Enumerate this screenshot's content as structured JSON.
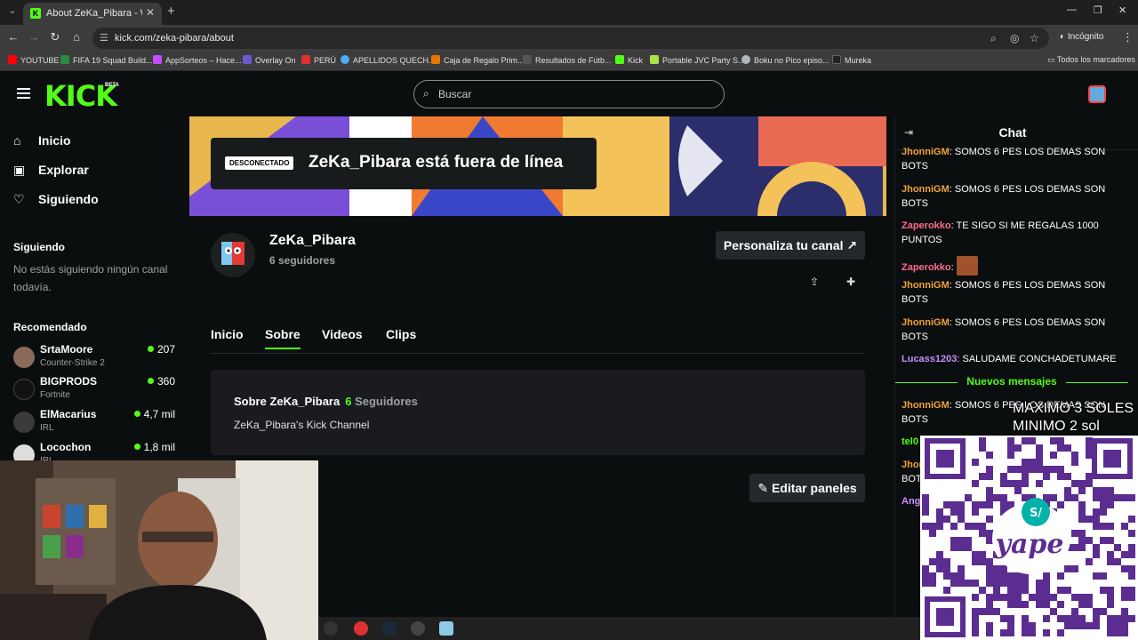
{
  "browser": {
    "tab_title": "About ZeKa_Pibara - Watch Live",
    "url": "kick.com/zeka-pibara/about",
    "incognito_label": "Incógnito",
    "bookmarks": [
      "YOUTUBE",
      "FIFA 19 Squad Build...",
      "AppSorteos – Hace...",
      "Overlay On",
      "PERÚ",
      "APELLIDOS QUECH...",
      "Caja de Regalo Prim...",
      "Resultados de Fútb...",
      "Kick",
      "Portable JVC Party S...",
      "Boku no Pico episo...",
      "Mureka"
    ],
    "all_bookmarks": "Todos los marcadores"
  },
  "header": {
    "logo": "KICK",
    "logo_badge": "BETA",
    "search_placeholder": "Buscar"
  },
  "sidebar": {
    "nav": [
      {
        "label": "Inicio",
        "icon": "home-icon"
      },
      {
        "label": "Explorar",
        "icon": "compass-icon"
      },
      {
        "label": "Siguiendo",
        "icon": "heart-icon"
      }
    ],
    "following_title": "Siguiendo",
    "following_empty": "No estás siguiendo ningún canal todavía.",
    "recommended_title": "Recomendado",
    "recommended": [
      {
        "name": "SrtaMoore",
        "category": "Counter-Strike 2",
        "viewers": "207"
      },
      {
        "name": "BIGPRODS",
        "category": "Fortnite",
        "viewers": "360"
      },
      {
        "name": "ElMacarius",
        "category": "IRL",
        "viewers": "4,7 mil"
      },
      {
        "name": "Locochon",
        "category": "IRL",
        "viewers": "1,8 mil"
      }
    ]
  },
  "channel": {
    "offline_badge": "DESCONECTADO",
    "offline_title": "ZeKa_Pibara está fuera de línea",
    "name": "ZeKa_Pibara",
    "followers": "6 seguidores",
    "customize_button": "Personaliza tu canal",
    "tabs": [
      "Inicio",
      "Sobre",
      "Videos",
      "Clips"
    ],
    "active_tab": "Sobre",
    "about_title": "Sobre ZeKa_Pibara",
    "about_count": "6",
    "about_count_label": "Seguidores",
    "about_description": "ZeKa_Pibara's Kick Channel",
    "edit_panels_button": "Editar paneles"
  },
  "chat": {
    "title": "Chat",
    "messages": [
      {
        "user": "JhonniGM",
        "text": ": SOMOS 6 PES LOS DEMAS SON BOTS",
        "color": "#f0a038"
      },
      {
        "user": "JhonniGM",
        "text": ": SOMOS 6 PES LOS DEMAS SON BOTS",
        "color": "#f0a038"
      },
      {
        "user": "Zaperokko",
        "text": ": TE SIGO SI ME REGALAS 1000 PUNTOS",
        "color": "#ff6b8a"
      },
      {
        "user": "Zaperokko",
        "text": ":",
        "color": "#ff6b8a"
      },
      {
        "user": "JhonniGM",
        "text": ": SOMOS 6 PES LOS DEMAS SON BOTS",
        "color": "#f0a038"
      },
      {
        "user": "JhonniGM",
        "text": ": SOMOS 6 PES LOS DEMAS SON BOTS",
        "color": "#f0a038"
      },
      {
        "user": "Lucass1203",
        "text": ": SALUDAME CONCHADETUMARE",
        "color": "#c88cff"
      }
    ],
    "new_messages_label": "Nuevos mensajes",
    "new_messages": [
      {
        "user": "JhonniGM",
        "text": ": SOMOS 6 PES LOS DEMAS SON BOTS",
        "color": "#f0a038"
      },
      {
        "user": "tel0",
        "text": "",
        "color": "#53fc18"
      },
      {
        "user": "Jhon",
        "text": "",
        "color": "#f0a038"
      },
      {
        "user": "",
        "text": "BOT",
        "color": "#ffffff"
      },
      {
        "user": "Ang",
        "text": "",
        "color": "#c88cff"
      }
    ]
  },
  "overlay": {
    "max_text": "MAXIMO 3 SOLES",
    "min_text": "MINIMO 2 sol",
    "qr_brand": "yape",
    "qr_currency": "S/"
  },
  "colors": {
    "accent": "#53fc18",
    "background": "#0b0e0f",
    "card": "#191b1f"
  }
}
